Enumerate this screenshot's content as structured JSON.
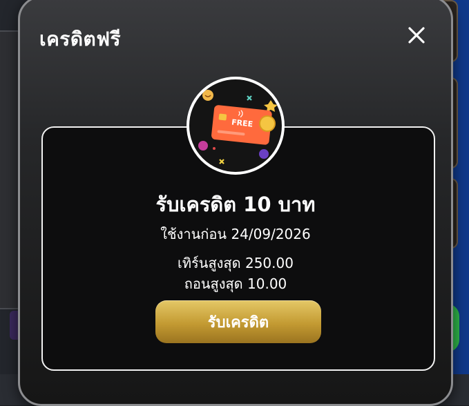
{
  "modal": {
    "title": "เครดิตฟรี",
    "close_icon": "close-icon",
    "badge_text": "FREE",
    "reward_title": "รับเครดิต 10 บาท",
    "use_before": "ใช้งานก่อน 24/09/2026",
    "turnover_max": "เทิร์นสูงสุด 250.00",
    "withdraw_max": "ถอนสูงสุด 10.00",
    "claim_button": "รับเครดิต"
  },
  "colors": {
    "accent_gold": "#c39a32",
    "card_orange": "#ff6a3d",
    "background": "#161616"
  }
}
